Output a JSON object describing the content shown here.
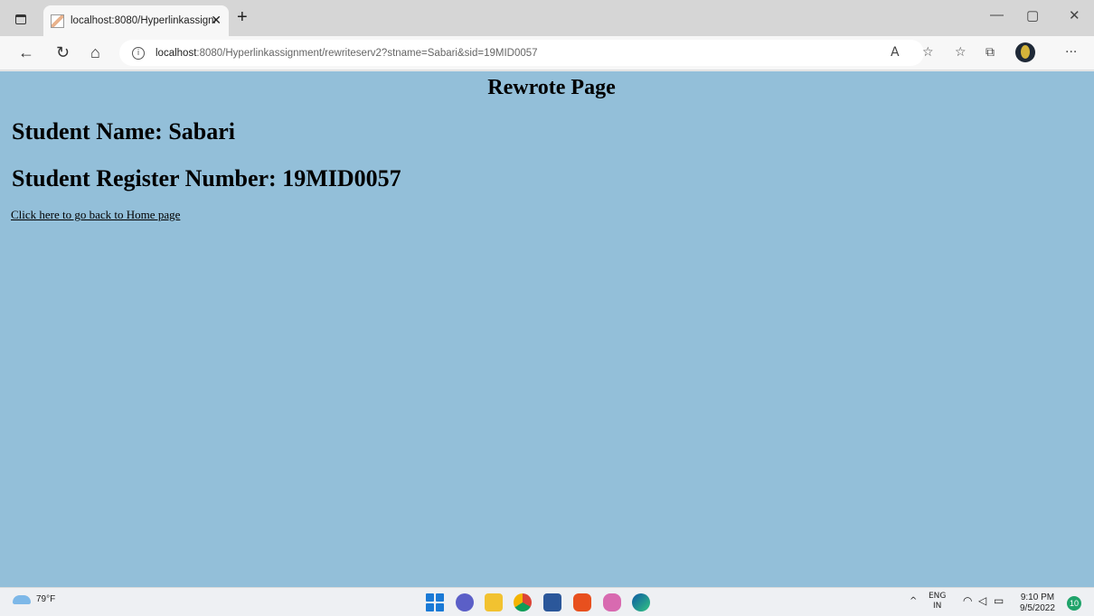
{
  "browser": {
    "tab_title": "localhost:8080/Hyperlinkassignm",
    "tab_close": "✕",
    "new_tab": "+",
    "minimize": "—",
    "maximize": "▢",
    "close": "✕",
    "url_host": "localhost",
    "url_rest": ":8080/Hyperlinkassignment/rewriteserv2?stname=Sabari&sid=19MID0057",
    "nav_back": "←",
    "nav_refresh": "↻",
    "nav_home": "⌂",
    "tools": {
      "read_aloud": "A",
      "favorites_add": "☆",
      "favorites": "☆",
      "collections": "⧉",
      "more": "···"
    }
  },
  "page": {
    "heading": "Rewrote Page",
    "student_name": "Student Name: Sabari",
    "register_number": "Student Register Number: 19MID0057",
    "back_link": "Click here to go back to Home page",
    "background_color": "#93bfd9"
  },
  "taskbar": {
    "weather": "79°F",
    "language_top": "ENG",
    "language_bottom": "IN",
    "time": "9:10 PM",
    "date": "9/5/2022",
    "notification_count": "10",
    "tray_chevron": "^",
    "app_icons": [
      "start-icon",
      "teams-chat-icon",
      "file-explorer-icon",
      "chrome-icon",
      "word-icon",
      "office-icon",
      "snipping-tool-icon",
      "edge-icon"
    ]
  }
}
